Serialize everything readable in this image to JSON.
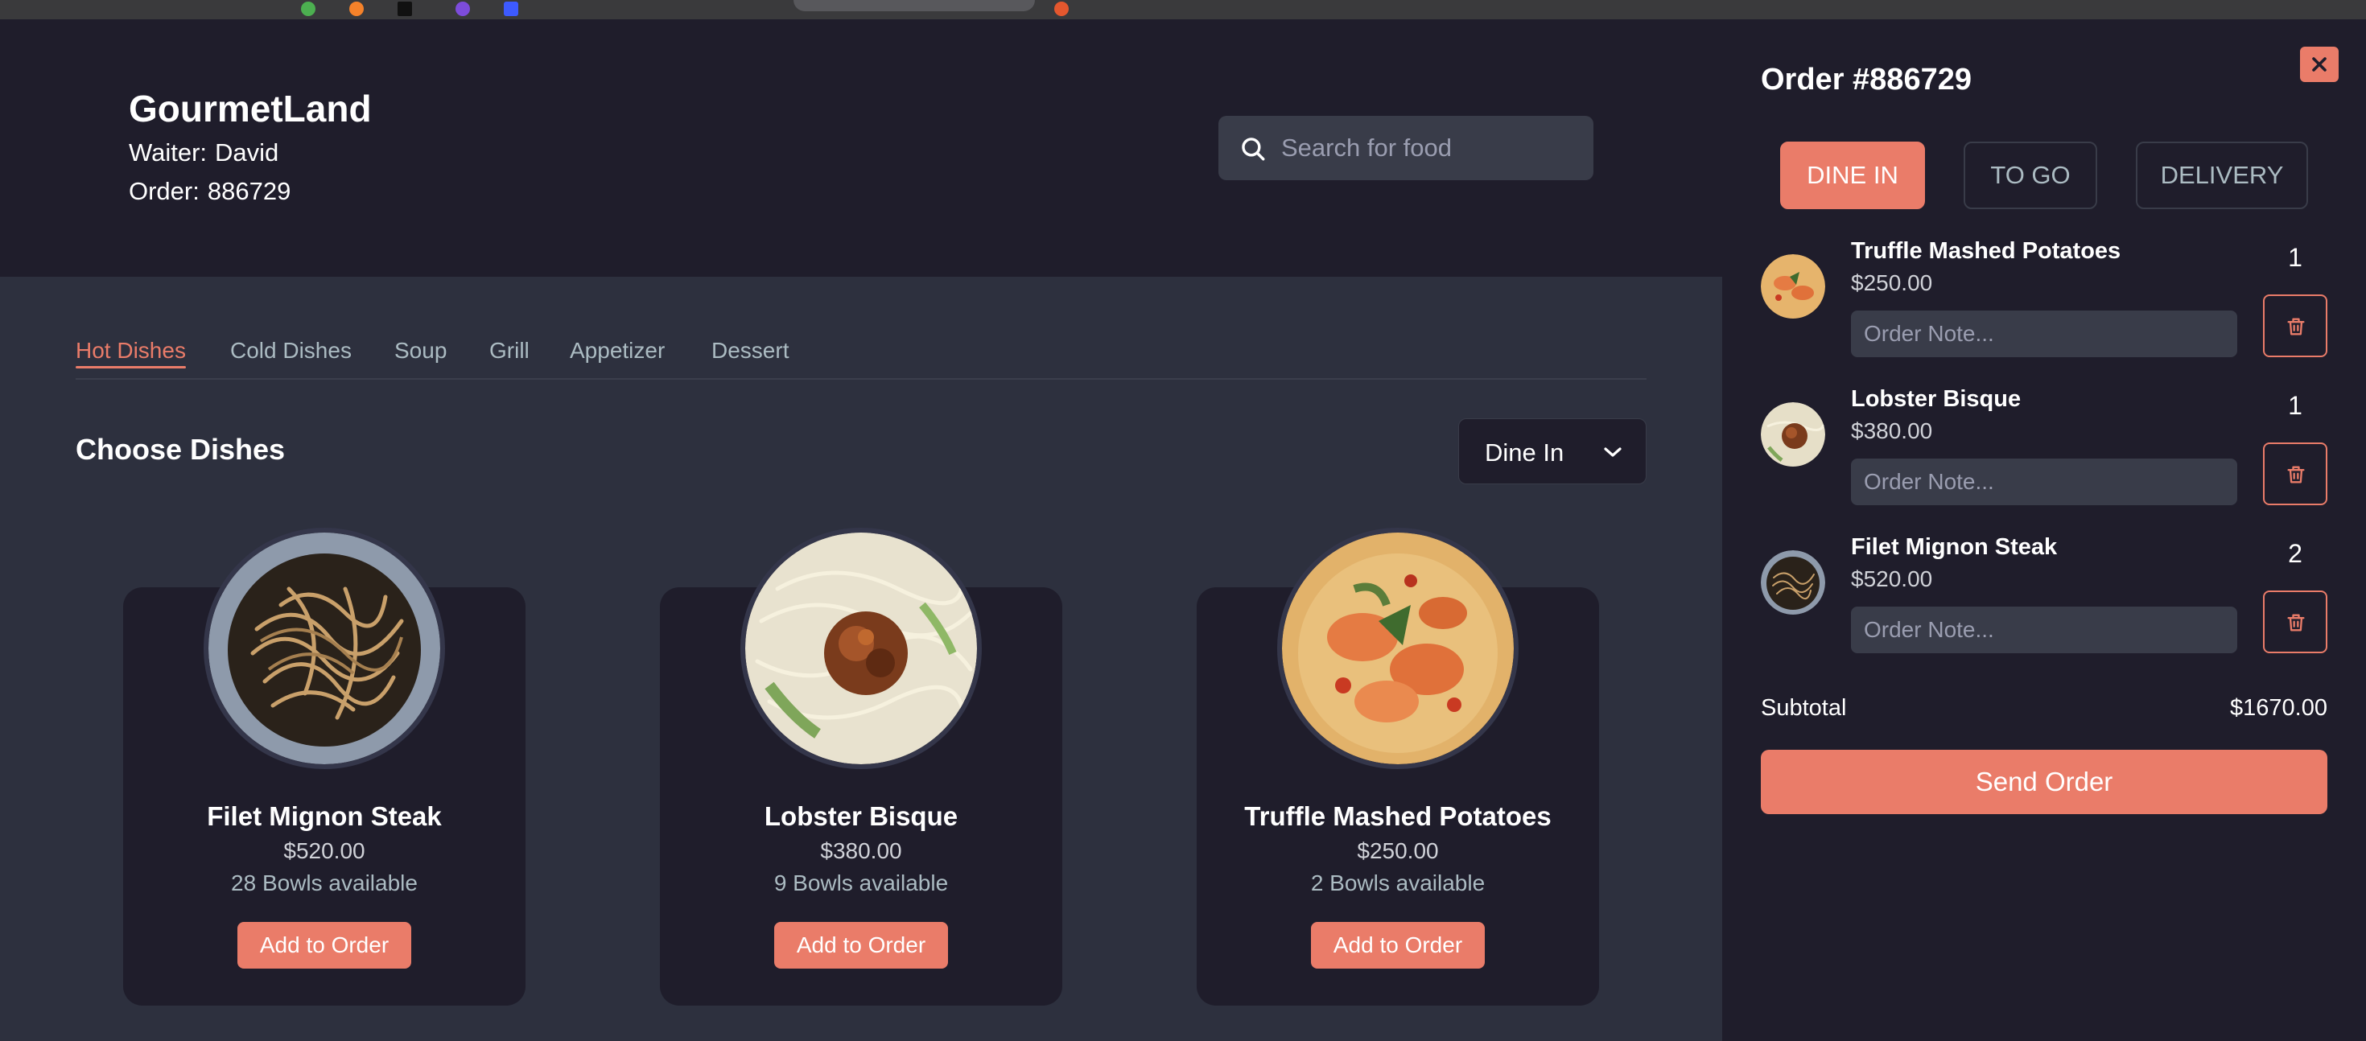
{
  "header": {
    "app_title": "GourmetLand",
    "waiter_label": "Waiter:",
    "waiter_name": "David",
    "order_label": "Order:",
    "order_number": "886729"
  },
  "search": {
    "placeholder": "Search for food",
    "icon": "search-icon"
  },
  "tabs": [
    {
      "label": "Hot Dishes",
      "active": true
    },
    {
      "label": "Cold Dishes",
      "active": false
    },
    {
      "label": "Soup",
      "active": false
    },
    {
      "label": "Grill",
      "active": false
    },
    {
      "label": "Appetizer",
      "active": false
    },
    {
      "label": "Dessert",
      "active": false
    }
  ],
  "section": {
    "title": "Choose Dishes",
    "mode_select_value": "Dine In",
    "mode_select_icon": "chevron-down-icon"
  },
  "dishes": [
    {
      "name": "Filet Mignon Steak",
      "price": "$520.00",
      "stock": "28 Bowls available",
      "button": "Add to Order"
    },
    {
      "name": "Lobster Bisque",
      "price": "$380.00",
      "stock": "9 Bowls available",
      "button": "Add to Order"
    },
    {
      "name": "Truffle Mashed Potatoes",
      "price": "$250.00",
      "stock": "2 Bowls available",
      "button": "Add to Order"
    }
  ],
  "order_panel": {
    "title": "Order #886729",
    "close_icon": "close-icon",
    "modes": [
      {
        "label": "DINE IN",
        "active": true
      },
      {
        "label": "TO GO",
        "active": false
      },
      {
        "label": "DELIVERY",
        "active": false
      }
    ],
    "items": [
      {
        "name": "Truffle Mashed Potatoes",
        "price": "$250.00",
        "quantity": "1",
        "note_placeholder": "Order Note..."
      },
      {
        "name": "Lobster Bisque",
        "price": "$380.00",
        "quantity": "1",
        "note_placeholder": "Order Note..."
      },
      {
        "name": "Filet Mignon Steak",
        "price": "$520.00",
        "quantity": "2",
        "note_placeholder": "Order Note..."
      }
    ],
    "delete_icon": "trash-icon",
    "subtotal_label": "Subtotal",
    "subtotal_value": "$1670.00",
    "send_button": "Send Order"
  },
  "colors": {
    "accent": "#ea7c69",
    "background": "#252836",
    "panel": "#1f1d2b",
    "field": "#393c49",
    "muted_text": "#abbbc2"
  }
}
